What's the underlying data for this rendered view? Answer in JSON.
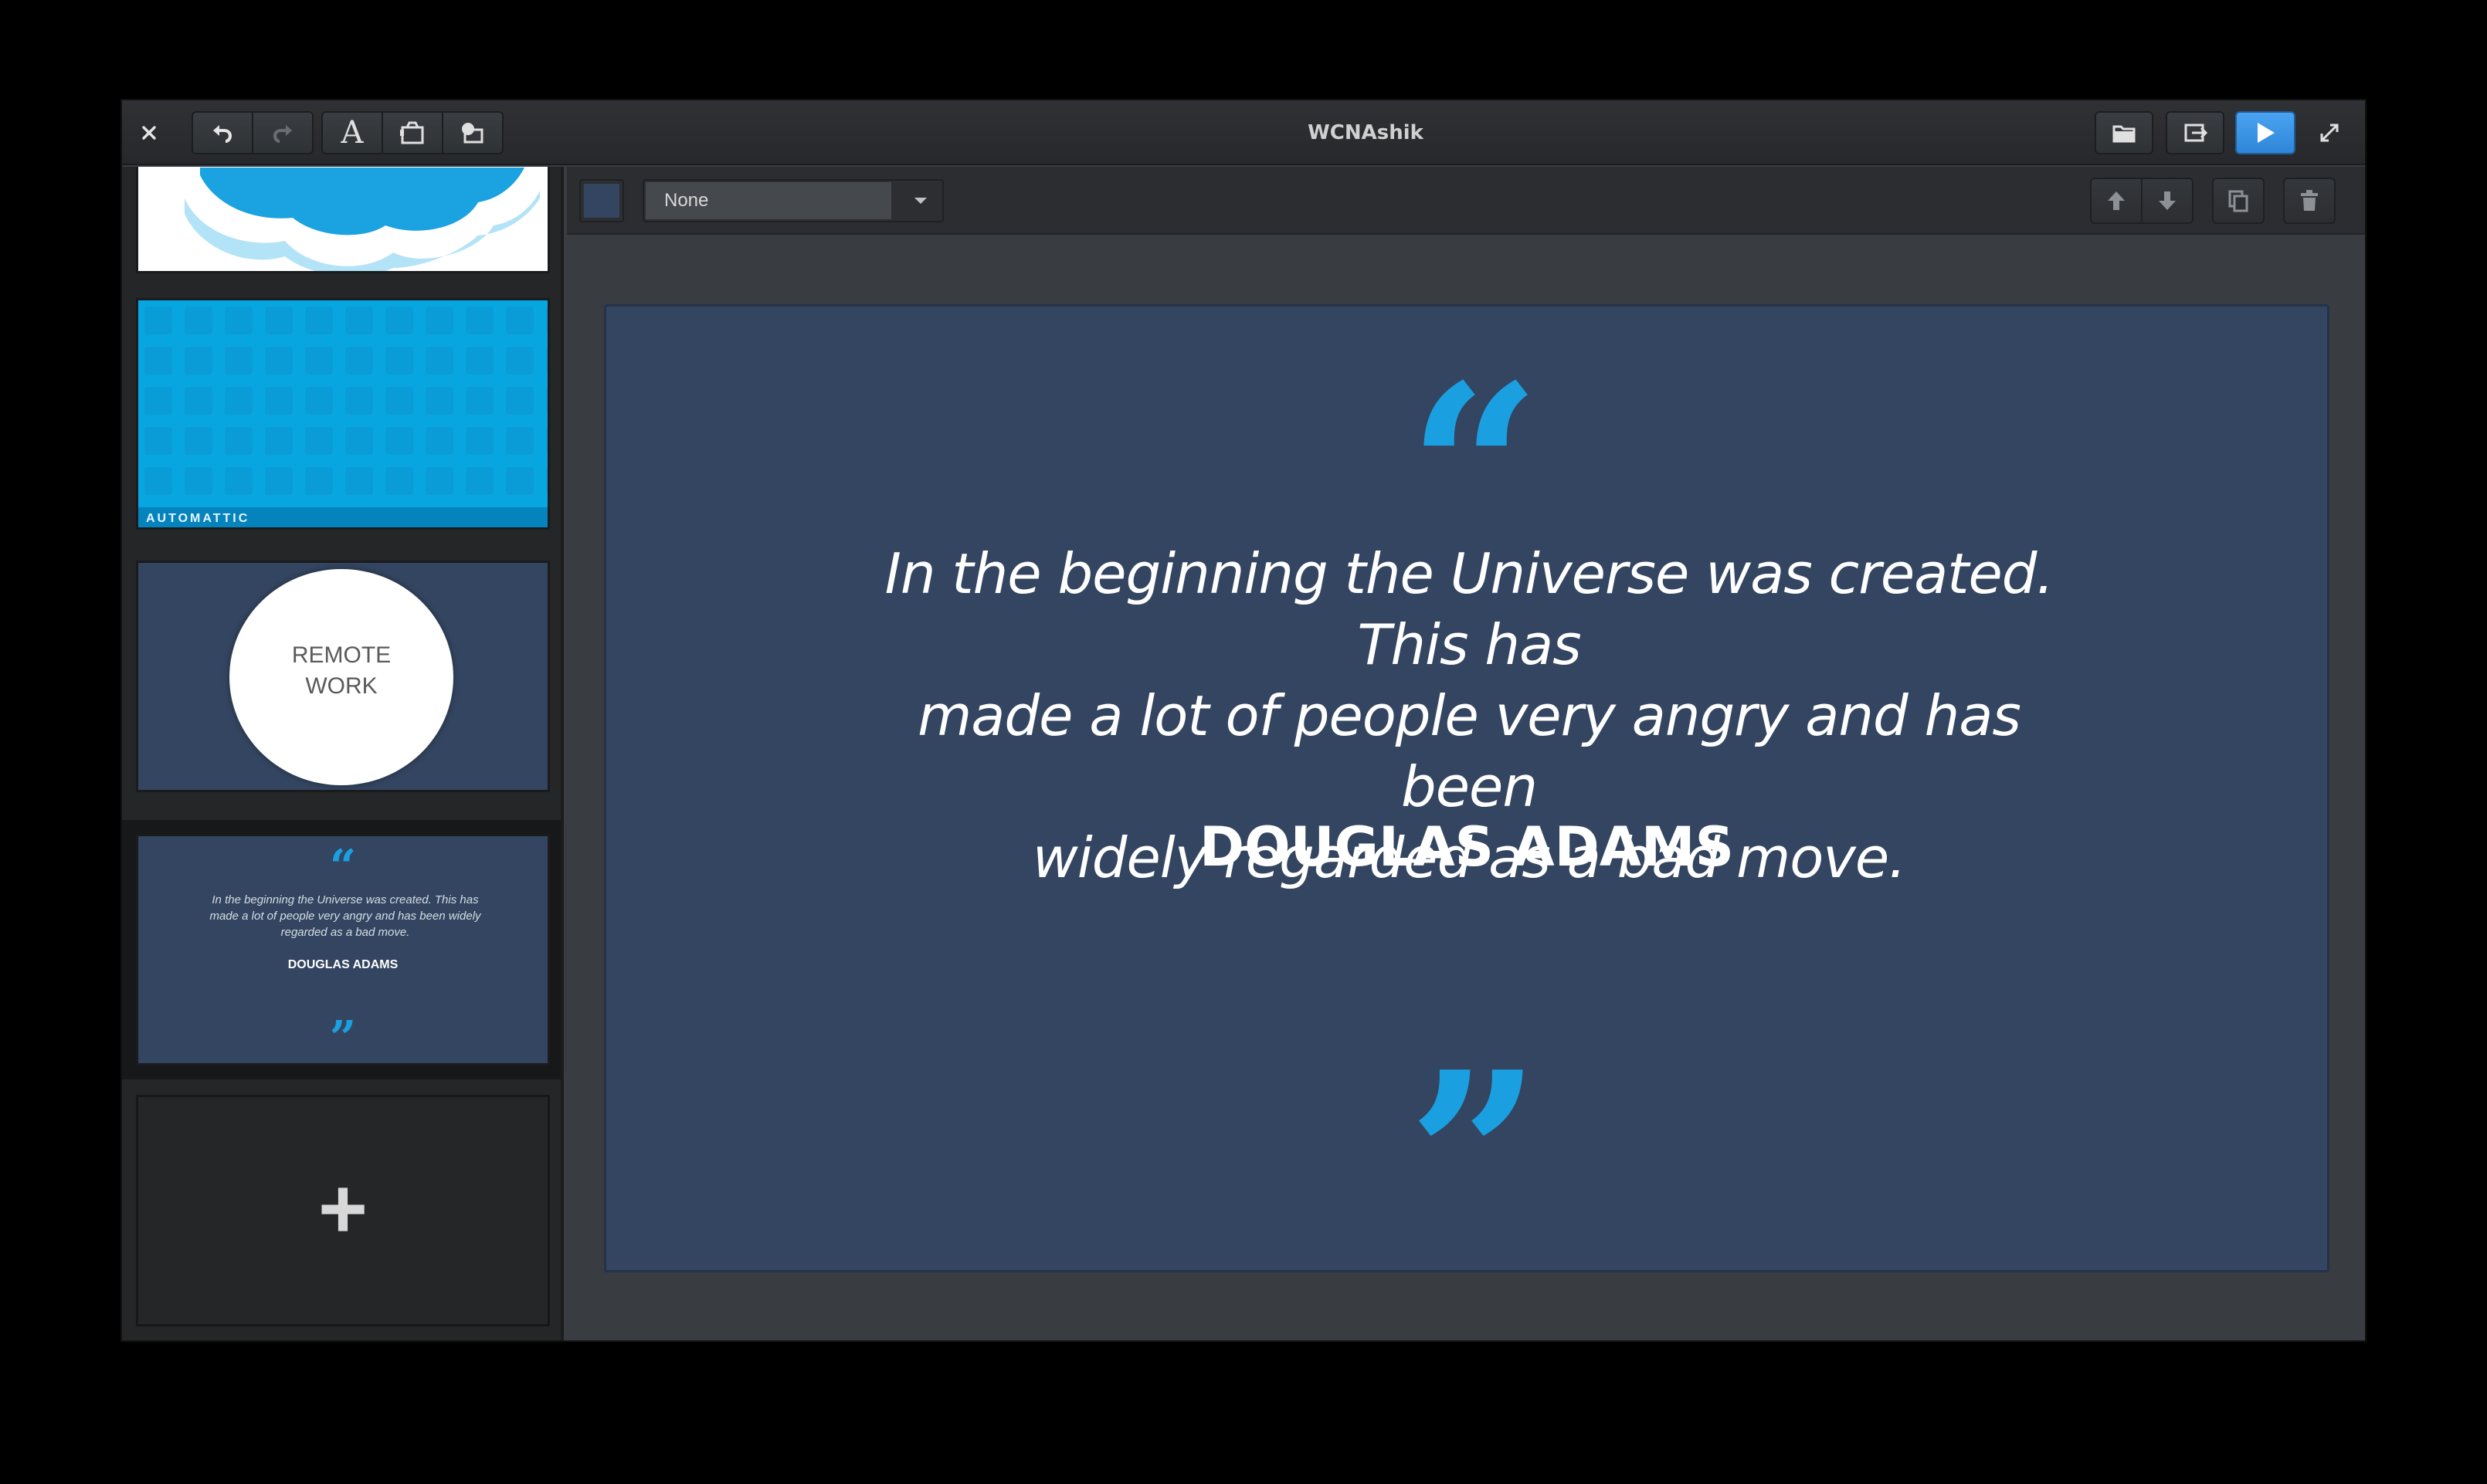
{
  "window": {
    "title": "WCNAshik"
  },
  "headerbar": {
    "close_icon": "close-icon",
    "undo_icon": "undo-icon",
    "redo_icon": "redo-icon",
    "text_tool_label": "A",
    "present_color": "#3b93e6"
  },
  "toolbar": {
    "fill_color": "#334560",
    "style_select": {
      "value": "None"
    }
  },
  "sidebar": {
    "slides": [
      {
        "type": "image-clouds"
      },
      {
        "type": "pattern",
        "footer": "AUTOMATTIC"
      },
      {
        "type": "circle",
        "text_line1": "REMOTE",
        "text_line2": "WORK"
      },
      {
        "type": "quote",
        "selected": true,
        "quote": "In the beginning the Universe was created. This has made a lot of people very angry and has been widely regarded as a bad move.",
        "author": "DOUGLAS ADAMS"
      },
      {
        "type": "add",
        "label": "+"
      }
    ]
  },
  "slide": {
    "open_quote": "“",
    "close_quote": "”",
    "quote_line1": "In the beginning the Universe was created. This has",
    "quote_line2": "made a lot of people very angry and has been",
    "quote_line3": "widely regarded as a bad move.",
    "author": "DOUGLAS ADAMS",
    "background": "#334560",
    "accent": "#1a9fe0"
  }
}
